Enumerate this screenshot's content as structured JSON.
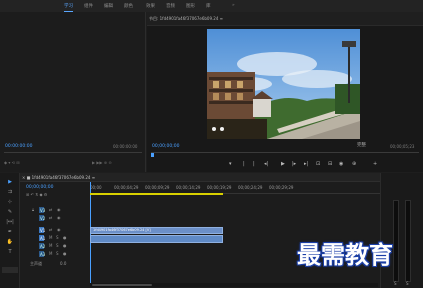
{
  "topbar": {
    "workspaces": [
      {
        "label": "学习",
        "active": true
      },
      {
        "label": "组件",
        "active": false
      },
      {
        "label": "编辑",
        "active": false
      },
      {
        "label": "颜色",
        "active": false
      },
      {
        "label": "效果",
        "active": false
      },
      {
        "label": "音频",
        "active": false
      },
      {
        "label": "图形",
        "active": false
      },
      {
        "label": "库",
        "active": false
      }
    ]
  },
  "source": {
    "timecode_left": "00:00:00:00",
    "timecode_right": "00:00:00:00"
  },
  "program": {
    "title": "节目: 1fd4901fa46f37067e6b09.24 ≡",
    "timecode_left": "00;00;00;00",
    "fit_label": "完整",
    "timecode_right": "00;00;05;23"
  },
  "timeline": {
    "tab_label": "× ■ 1fd4901fa46f37067e6b09.24 ≡",
    "playhead_time": "00;00;00;00",
    "ruler_labels": [
      "00;00",
      "00;00;04;29",
      "00;00;09;29",
      "00;00;14;29",
      "00;00;19;29",
      "00;00;24;29",
      "00;00;29;29"
    ],
    "tracks": [
      {
        "name": "V3",
        "type": "video"
      },
      {
        "name": "V2",
        "type": "video"
      },
      {
        "name": "V1",
        "type": "video"
      },
      {
        "name": "A1",
        "type": "audio"
      },
      {
        "name": "A2",
        "type": "audio"
      },
      {
        "name": "A3",
        "type": "audio"
      },
      {
        "name": "主声道",
        "type": "master",
        "value": "0.0"
      }
    ],
    "video_clip_label": "1fd4901fa46f37067e6b09.24 [V]",
    "audio_clip_label": ""
  },
  "meter": {
    "labels": [
      "S",
      "S"
    ]
  },
  "watermark": {
    "text": "最需教育"
  },
  "colors": {
    "accent": "#4aa0ff",
    "clip_video": "#6b8fc7",
    "clip_audio": "#5f8ac6",
    "work_area": "#d8d000"
  }
}
